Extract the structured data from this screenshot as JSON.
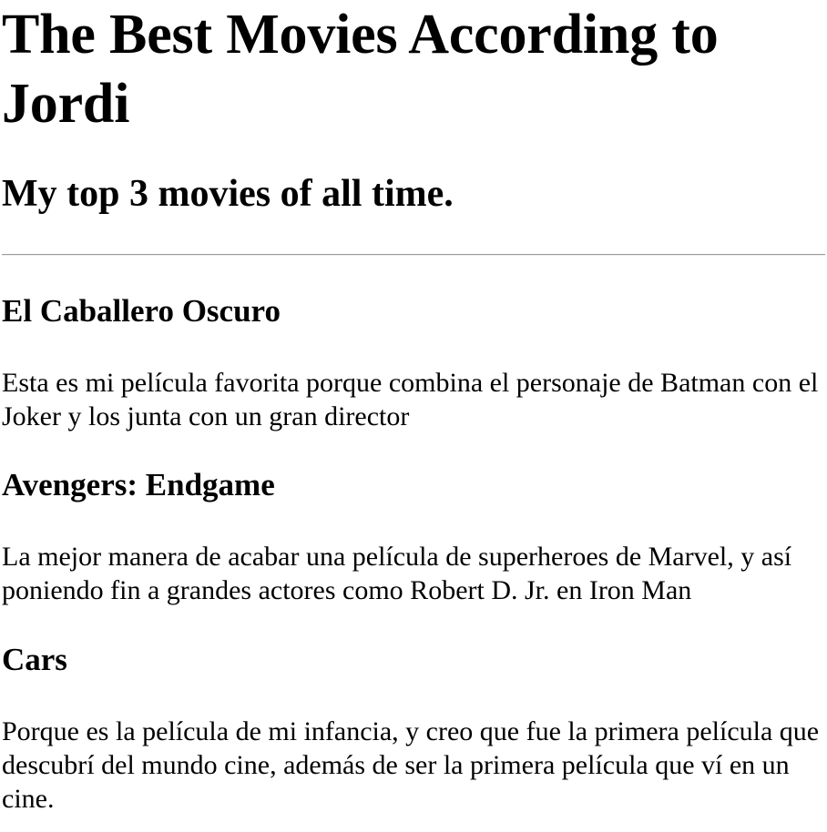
{
  "header": {
    "title": "The Best Movies According to Jordi",
    "subtitle": "My top 3 movies of all time."
  },
  "movies": [
    {
      "title": "El Caballero Oscuro",
      "description": "Esta es mi película favorita porque combina el personaje de Batman con el Joker y los junta con un gran director"
    },
    {
      "title": "Avengers: Endgame",
      "description": "La mejor manera de acabar una película de superheroes de Marvel, y así poniendo fin a grandes actores como Robert D. Jr. en Iron Man"
    },
    {
      "title": "Cars",
      "description": "Porque es la película de mi infancia, y creo que fue la primera película que descubrí del mundo cine, además de ser la primera película que ví en un cine."
    }
  ]
}
